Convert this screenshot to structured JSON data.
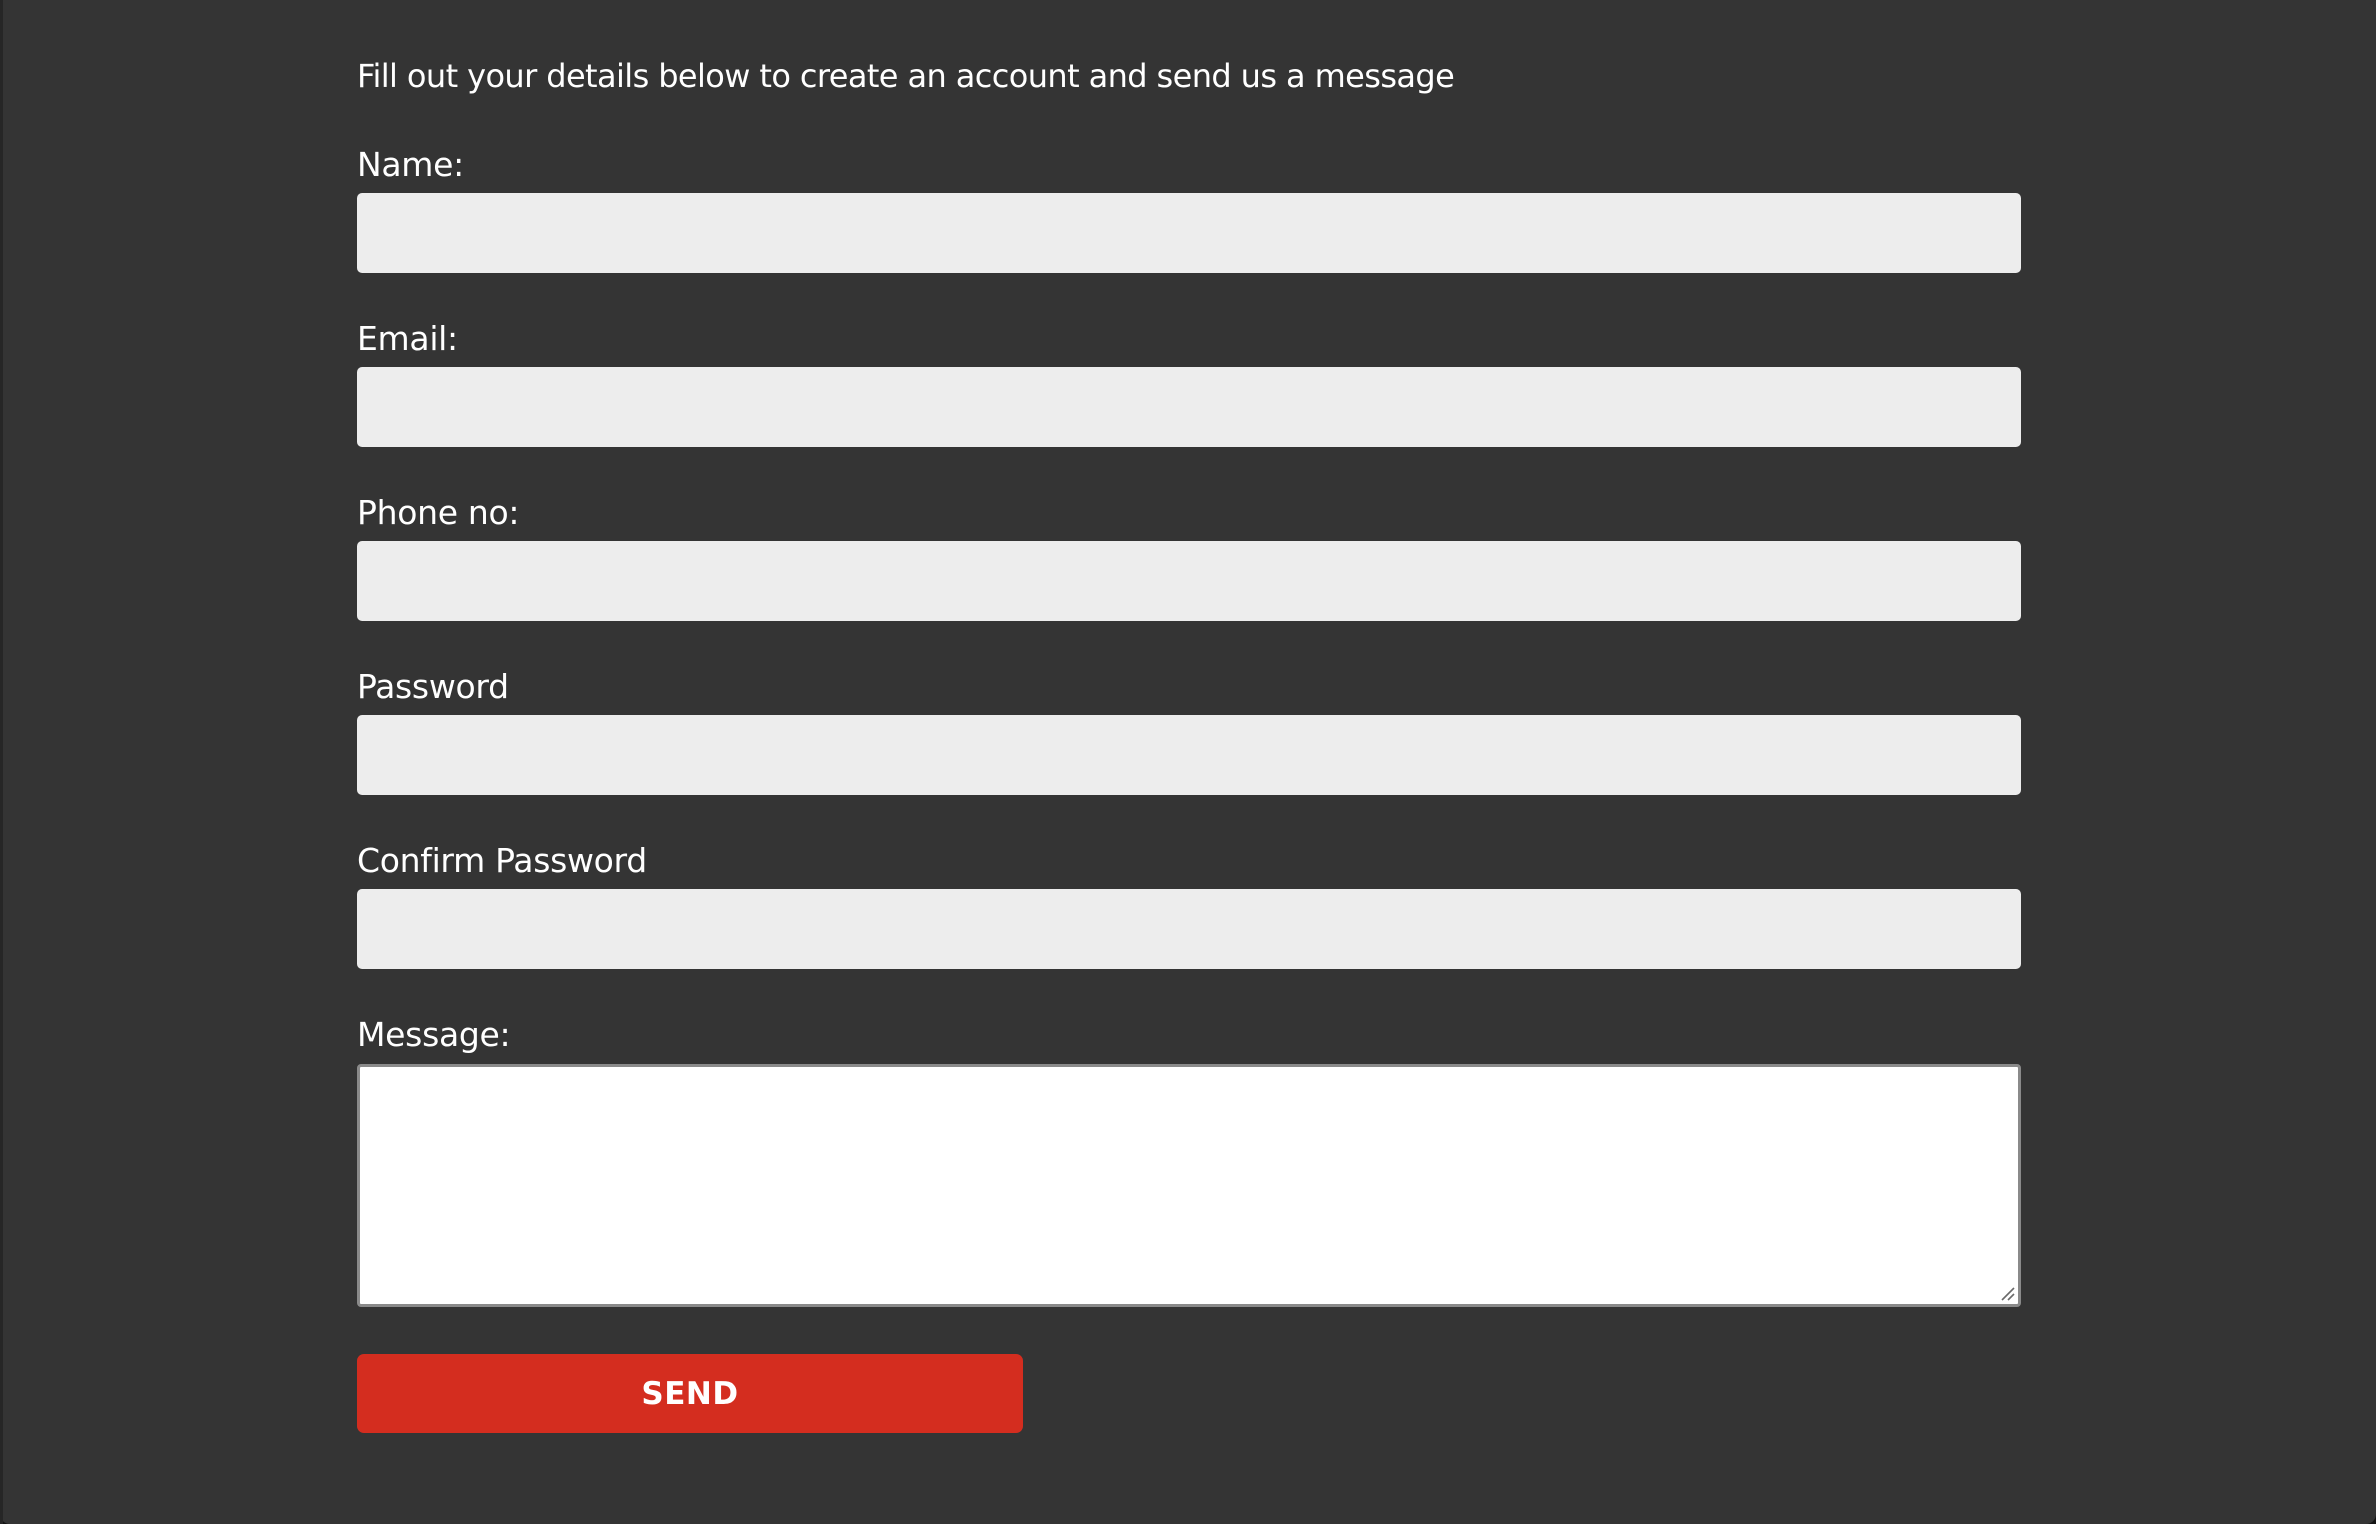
{
  "form": {
    "intro": "Fill out your details below to create an account and send us a message",
    "name_label": "Name:",
    "name_value": "",
    "email_label": "Email:",
    "email_value": "",
    "phone_label": "Phone no:",
    "phone_value": "",
    "password_label": "Password",
    "password_value": "",
    "confirm_password_label": "Confirm Password",
    "confirm_password_value": "",
    "message_label": "Message:",
    "message_value": "",
    "send_label": "SEND",
    "resize_icon": "resize-handle-icon"
  },
  "colors": {
    "page_background": "#343434",
    "input_background": "#ededed",
    "message_background": "#ffffff",
    "send_button": "#d42d1f",
    "text": "#ffffff"
  }
}
